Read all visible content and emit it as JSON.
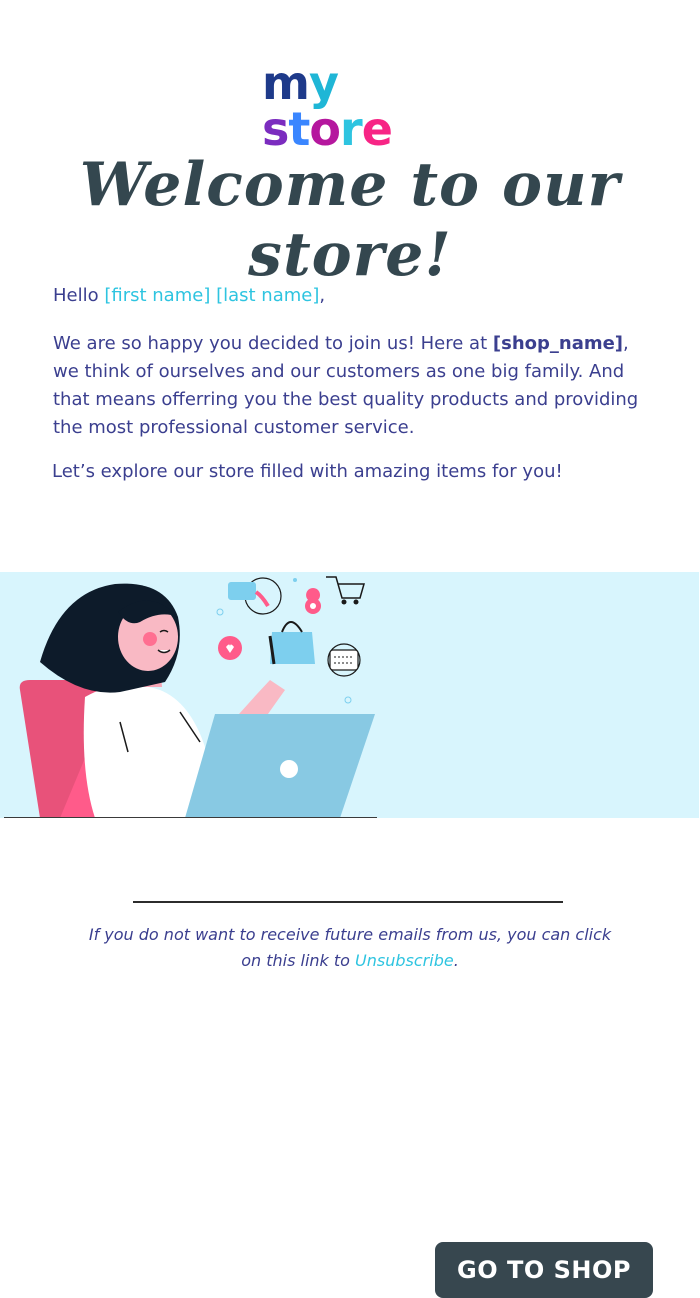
{
  "logo": {
    "text": "my store",
    "letters": [
      {
        "char": "m",
        "color": "#1e3a8a"
      },
      {
        "char": "y",
        "color": "#1fb6d6"
      },
      {
        "char": " ",
        "color": "#ffffff"
      },
      {
        "char": "s",
        "color": "#7b2cbf"
      },
      {
        "char": "t",
        "color": "#3a86ff"
      },
      {
        "char": "o",
        "color": "#b5179e"
      },
      {
        "char": "r",
        "color": "#2ec4e0"
      },
      {
        "char": "e",
        "color": "#f72585"
      }
    ]
  },
  "header": {
    "title": "Welcome to our store!"
  },
  "greeting": {
    "hello": "Hello",
    "first_name": "[first name]",
    "last_name": "[last name]",
    "comma": ","
  },
  "intro": {
    "before": "We are so happy you decided to join us! Here at ",
    "shop_token": "[shop_name]",
    "after": ", we think of ourselves and our customers as one big family. And that means offerring you the best quality products and providing the most professional customer service."
  },
  "explore": "Let’s explore our store filled with amazing items for you!",
  "banner": {
    "cta_label": "GO TO SHOP",
    "illustration": "woman-shopping-online-laptop",
    "bg_color": "#d8f5fd"
  },
  "footer": {
    "text": "If you do not want to receive future emails from us, you can click on this link to ",
    "link_text": "Unsubscribe",
    "end": "."
  },
  "colors": {
    "accent": "#2ec4e0",
    "body_text": "#3b3f8f",
    "title": "#34474f",
    "button": "#37474f"
  }
}
